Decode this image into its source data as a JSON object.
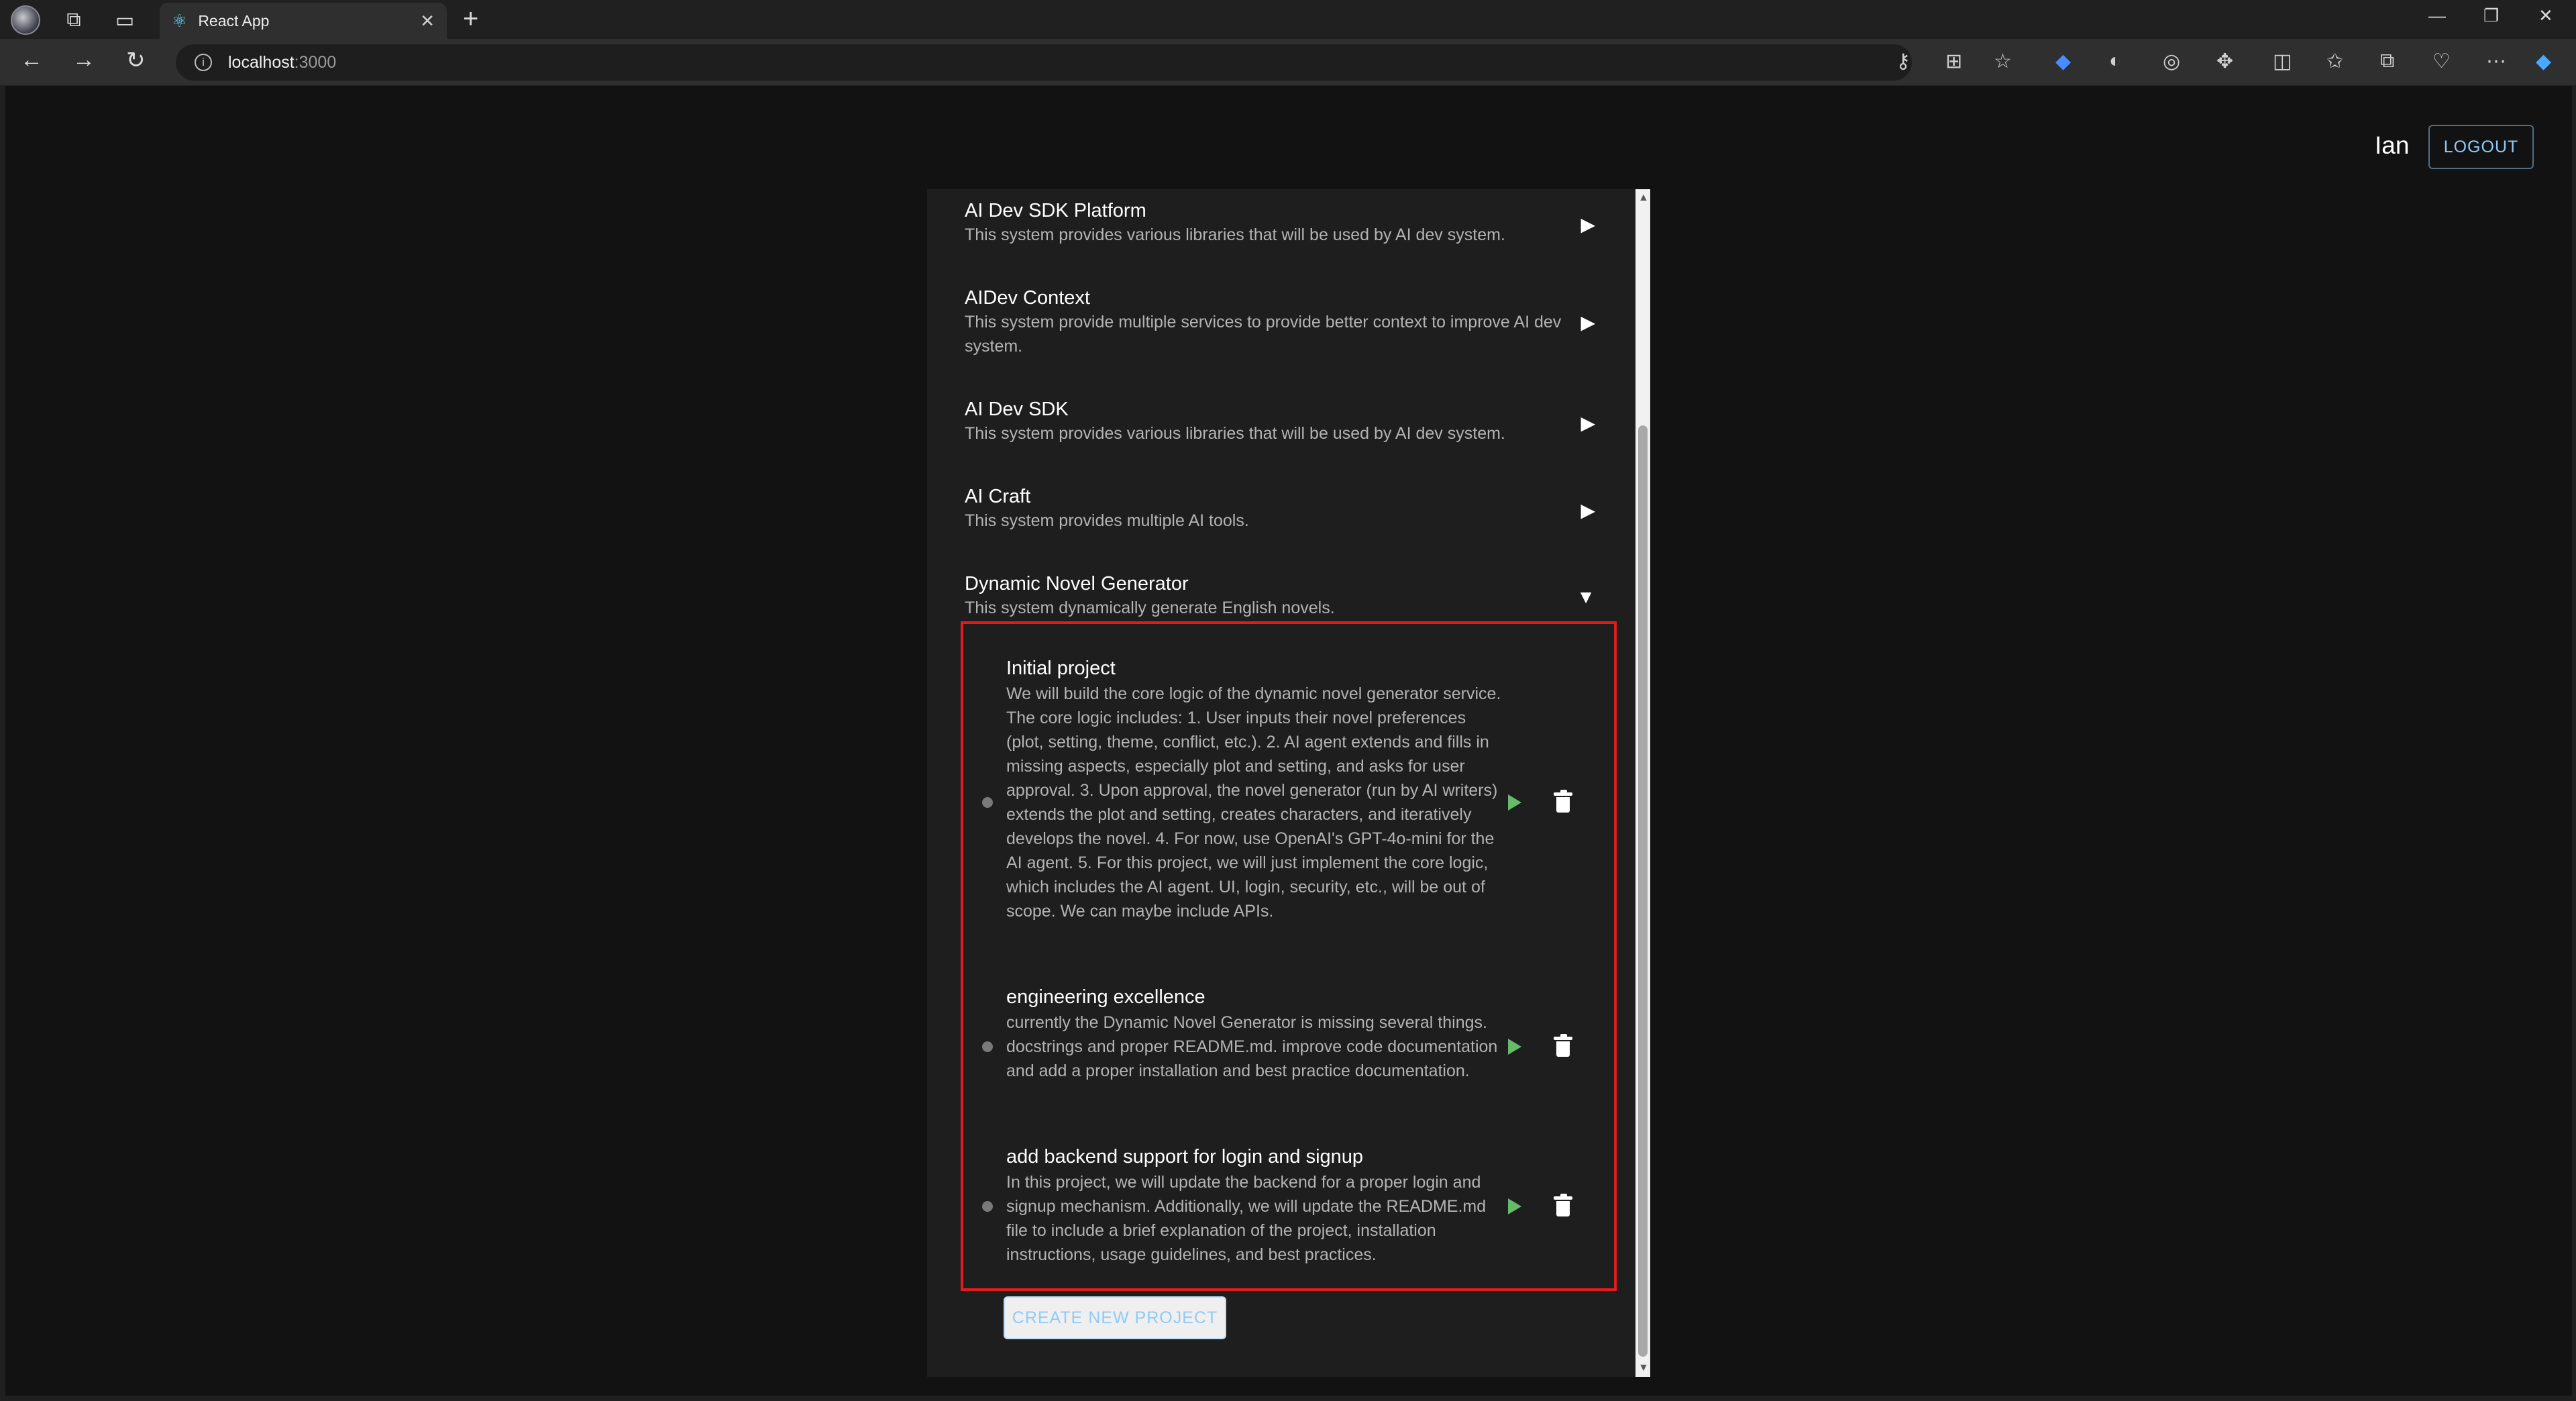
{
  "browser": {
    "tab_title": "React App",
    "url_host": "localhost",
    "url_port": ":3000"
  },
  "header": {
    "user_name": "Ian",
    "logout_label": "LOGOUT"
  },
  "systems": [
    {
      "title": "AI Dev SDK Platform",
      "description": "This system provides various libraries that will be used by AI dev system.",
      "expanded": false
    },
    {
      "title": "AIDev Context",
      "description": "This system provide multiple services to provide better context to improve AI dev system.",
      "expanded": false
    },
    {
      "title": "AI Dev SDK",
      "description": "This system provides various libraries that will be used by AI dev system.",
      "expanded": false
    },
    {
      "title": "AI Craft",
      "description": "This system provides multiple AI tools.",
      "expanded": false
    },
    {
      "title": "Dynamic Novel Generator",
      "description": "This system dynamically generate English novels.",
      "expanded": true
    }
  ],
  "projects": [
    {
      "title": "Initial project",
      "description": "We will build the core logic of the dynamic novel generator service. The core logic includes: 1. User inputs their novel preferences (plot, setting, theme, conflict, etc.). 2. AI agent extends and fills in missing aspects, especially plot and setting, and asks for user approval. 3. Upon approval, the novel generator (run by AI writers) extends the plot and setting, creates characters, and iteratively develops the novel. 4. For now, use OpenAI's GPT-4o-mini for the AI agent. 5. For this project, we will just implement the core logic, which includes the AI agent. UI, login, security, etc., will be out of scope. We can maybe include APIs."
    },
    {
      "title": "engineering excellence",
      "description": "currently the Dynamic Novel Generator is missing several things. docstrings and proper README.md. improve code documentation and add a proper installation and best practice documentation."
    },
    {
      "title": "add backend support for login and signup",
      "description": "In this project, we will update the backend for a proper login and signup mechanism. Additionally, we will update the README.md file to include a brief explanation of the project, installation instructions, usage guidelines, and best practices."
    }
  ],
  "create_button_label": "CREATE NEW PROJECT",
  "colors": {
    "accent": "#90caf9",
    "play": "#66bb6a",
    "highlight": "#e01c1c"
  }
}
